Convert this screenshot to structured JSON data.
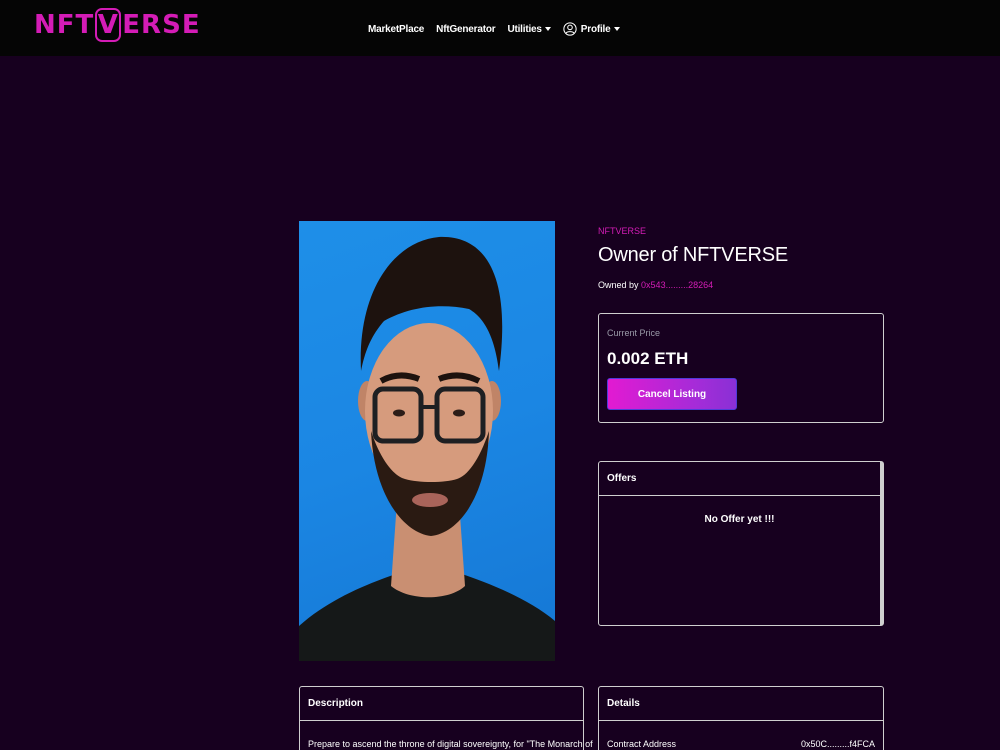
{
  "navbar": {
    "logo_parts": [
      "N",
      "F",
      "T",
      "V",
      "E",
      "R",
      "S",
      "E"
    ],
    "links": {
      "marketplace": "MarketPlace",
      "nft_generator": "NftGenerator",
      "utilities": "Utilities",
      "profile": "Profile"
    }
  },
  "nft": {
    "image_icon": "portrait-photo",
    "collection": "NFTVERSE",
    "title": "Owner of NFTVERSE",
    "owned_by_label": "Owned by",
    "owner_address": "0x543.........28264"
  },
  "price": {
    "label": "Current Price",
    "value": "0.002 ETH",
    "cancel_label": "Cancel Listing"
  },
  "offers": {
    "header": "Offers",
    "empty_text": "No Offer yet !!!"
  },
  "description": {
    "header": "Description",
    "text": "Prepare to ascend the throne of digital sovereignty, for \"The Monarch of"
  },
  "details": {
    "header": "Details",
    "contract_label": "Contract Address",
    "contract_value": "0x50C.........f4FCA"
  },
  "colors": {
    "background": "#17001f",
    "navbar": "#050505",
    "accent": "#d41cb6",
    "button_gradient_start": "#e21ad2",
    "button_gradient_end": "#8a30d5"
  }
}
